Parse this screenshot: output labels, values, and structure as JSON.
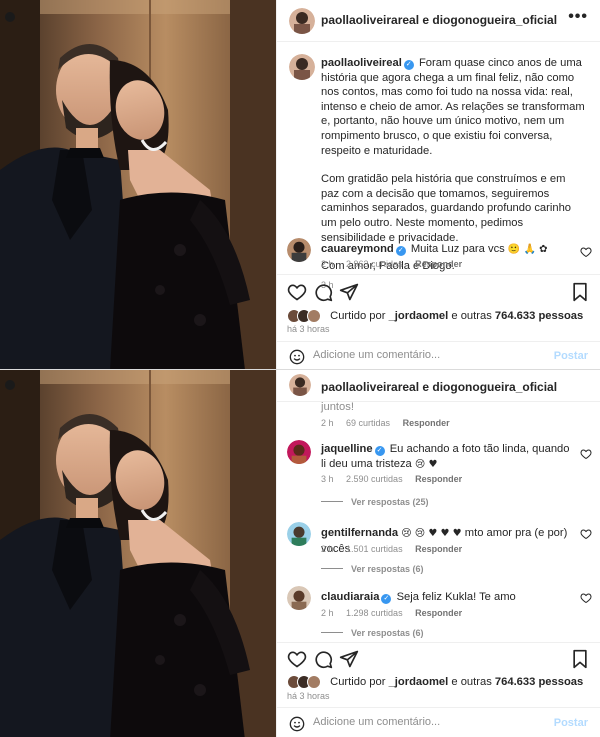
{
  "post": {
    "accounts_line": "paollaoliveirareal e diogonogueira_oficial",
    "caption_user": "paollaoliveireal",
    "caption_p1": "Foram quase cinco anos de uma história que agora chega a um final feliz, não como nos contos, mas como foi tudo na nossa vida: real, intenso e cheio de amor. As relações se transformam e, portanto, não houve um único motivo, nem um rompimento brusco, o que existiu foi conversa, respeito e maturidade.",
    "caption_p2": "Com gratidão pela história que construímos e em paz com a decisão que tomamos, seguiremos caminhos separados, guardando profundo carinho um pelo outro. Neste momento, pedimos sensibilidade e privacidade.",
    "caption_p3": "Com amor, Paolla e Diogo.",
    "caption_time": "3 h",
    "liked_by_prefix": "Curtido por",
    "liked_by_user": "_jordaomel",
    "liked_by_suffix": "e outras",
    "liked_by_count": "764.633 pessoas",
    "time_ago": "há 3 horas",
    "time_ago_short": "há 3 horas",
    "add_comment_placeholder": "Adicione um comentário...",
    "post_label": "Postar",
    "more_icon": "•••"
  },
  "top_comment": {
    "user": "cauareymond",
    "text": "Muita Luz para vcs",
    "emojis": "🙂 🙏 ✿",
    "time": "2 h",
    "likes": "2.963 curtidas",
    "reply": "Responder"
  },
  "comments": [
    {
      "user": "",
      "text": "juntos!",
      "time": "2 h",
      "likes": "69 curtidas",
      "reply": "Responder"
    },
    {
      "user": "jaquelline",
      "text": "Eu achando a foto tão linda, quando li deu uma tristeza",
      "emojis": "😢 ♥",
      "time": "3 h",
      "likes": "2.590 curtidas",
      "reply": "Responder",
      "view_replies": "Ver respostas (25)"
    },
    {
      "user": "gentilfernanda",
      "text": "mto amor pra (e por) vocês",
      "emojis": "😢 😢 ♥ ♥ ♥",
      "time": "2 h",
      "likes": "1.501 curtidas",
      "reply": "Responder",
      "view_replies": "Ver respostas (6)"
    },
    {
      "user": "claudiaraia",
      "text": "Seja feliz Kukla! Te amo",
      "time": "2 h",
      "likes": "1.298 curtidas",
      "reply": "Responder",
      "view_replies": "Ver respostas (6)"
    }
  ],
  "icons": {
    "like": "heart-icon",
    "comment": "comment-icon",
    "share": "share-icon",
    "save": "bookmark-icon",
    "emoji": "emoji-icon",
    "tag": "user-tag-icon"
  },
  "colors": {
    "verified": "#3897f0",
    "post_disabled": "#b3dbff",
    "muted": "#8e8e8e"
  }
}
